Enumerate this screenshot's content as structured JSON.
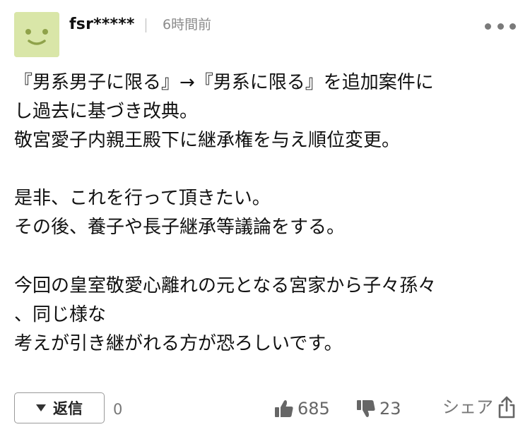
{
  "header": {
    "avatar_icon": "smiley-face-icon",
    "avatar_color": "#d9e6a8",
    "username": "fsr*****",
    "timestamp": "6時間前",
    "more_icon": "more-dots-icon"
  },
  "body": {
    "lines": [
      "『男系男子に限る』→『男系に限る』を追加案件に",
      "し過去に基づき改典。",
      "敬宮愛子内親王殿下に継承権を与え順位変更。",
      "",
      "是非、これを行って頂きたい。",
      "その後、養子や長子継承等議論をする。",
      "",
      "今回の皇室敬愛心離れの元となる宮家から子々孫々",
      "、同じ様な",
      "考えが引き継がれる方が恐ろしいです。"
    ]
  },
  "footer": {
    "reply_label": "返信",
    "reply_count": "0",
    "like_count": "685",
    "dislike_count": "23",
    "share_label": "シェア",
    "icons": {
      "reply": "caret-down-icon",
      "like": "thumbs-up-icon",
      "dislike": "thumbs-down-icon",
      "share": "share-icon"
    }
  }
}
